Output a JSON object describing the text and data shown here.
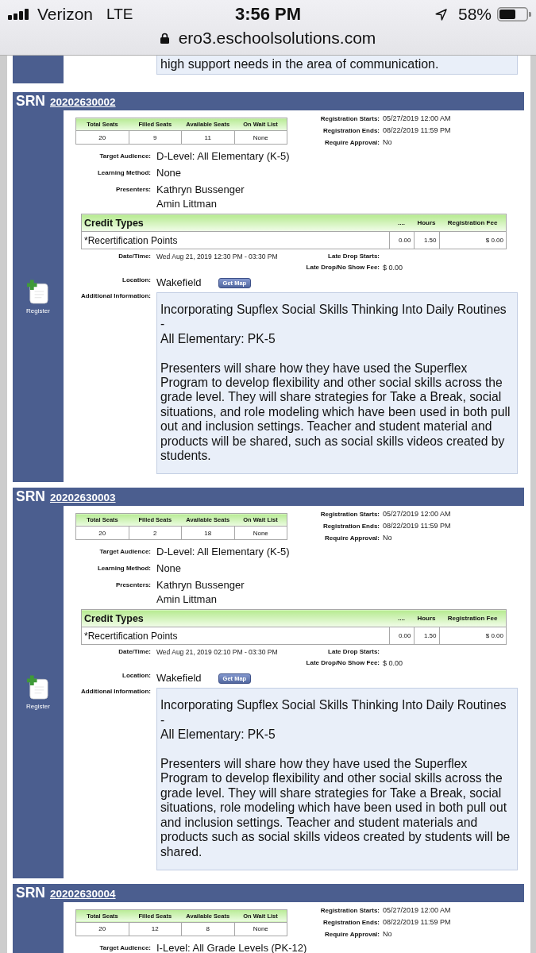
{
  "status_bar": {
    "carrier": "Verizon",
    "network": "LTE",
    "time": "3:56 PM",
    "battery": "58%",
    "url": "ero3.eschoolsolutions.com"
  },
  "previous_section": {
    "info_text": "high support needs in the area of communication."
  },
  "sections": [
    {
      "srn_label": "SRN",
      "srn": "20202630002",
      "seats": {
        "columns": [
          "Total Seats",
          "Filled Seats",
          "Available Seats",
          "On Wait List"
        ],
        "values": [
          "20",
          "9",
          "11",
          "None"
        ]
      },
      "registration": [
        {
          "label": "Registration Starts:",
          "value": "05/27/2019 12:00 AM"
        },
        {
          "label": "Registration Ends:",
          "value": "08/22/2019 11:59 PM"
        },
        {
          "label": "Require Approval:",
          "value": "No"
        }
      ],
      "details": [
        {
          "label": "Target Audience:",
          "values": [
            "D-Level: All Elementary (K-5)"
          ]
        },
        {
          "label": "Learning Method:",
          "values": [
            "None"
          ]
        },
        {
          "label": "Presenters:",
          "values": [
            "Kathryn Bussenger",
            "Amin Littman"
          ]
        }
      ],
      "credit_types": {
        "columns": [
          "Credit Types",
          "....",
          "Hours",
          "Registration Fee"
        ],
        "rows": [
          [
            "*Recertification Points",
            "0.00",
            "1.50",
            "$ 0.00"
          ]
        ]
      },
      "schedule": {
        "date_label": "Date/Time:",
        "date_value": "Wed Aug 21, 2019 12:30 PM - 03:30 PM",
        "late_drop_label": "Late Drop Starts:",
        "fee_label": "Late Drop/No Show Fee:",
        "fee_value": "$ 0.00"
      },
      "location": {
        "label": "Location:",
        "value": "Wakefield",
        "map_button": "Get Map"
      },
      "register_label": "Register",
      "additional_info": {
        "label": "Additional Information:",
        "title_lines": [
          "Incorporating Supflex Social Skills Thinking Into Daily Routines",
          "-",
          "All Elementary: PK-5"
        ],
        "description": "Presenters will share how they have used the Superflex Program to develop flexibility and other social skills across the grade level. They will share strategies for Take a Break, social situations, and role modeling which have been used in both pull out and inclusion settings. Teacher and student material and products will be shared, such as social skills videos created by students."
      }
    },
    {
      "srn_label": "SRN",
      "srn": "20202630003",
      "seats": {
        "columns": [
          "Total Seats",
          "Filled Seats",
          "Available Seats",
          "On Wait List"
        ],
        "values": [
          "20",
          "2",
          "18",
          "None"
        ]
      },
      "registration": [
        {
          "label": "Registration Starts:",
          "value": "05/27/2019 12:00 AM"
        },
        {
          "label": "Registration Ends:",
          "value": "08/22/2019 11:59 PM"
        },
        {
          "label": "Require Approval:",
          "value": "No"
        }
      ],
      "details": [
        {
          "label": "Target Audience:",
          "values": [
            "D-Level: All Elementary (K-5)"
          ]
        },
        {
          "label": "Learning Method:",
          "values": [
            "None"
          ]
        },
        {
          "label": "Presenters:",
          "values": [
            "Kathryn Bussenger",
            "Amin Littman"
          ]
        }
      ],
      "credit_types": {
        "columns": [
          "Credit Types",
          "....",
          "Hours",
          "Registration Fee"
        ],
        "rows": [
          [
            "*Recertification Points",
            "0.00",
            "1.50",
            "$ 0.00"
          ]
        ]
      },
      "schedule": {
        "date_label": "Date/Time:",
        "date_value": "Wed Aug 21, 2019 02:10 PM - 03:30 PM",
        "late_drop_label": "Late Drop Starts:",
        "fee_label": "Late Drop/No Show Fee:",
        "fee_value": "$ 0.00"
      },
      "location": {
        "label": "Location:",
        "value": "Wakefield",
        "map_button": "Get Map"
      },
      "register_label": "Register",
      "additional_info": {
        "label": "Additional Information:",
        "title_lines": [
          "Incorporating Supflex Social Skills Thinking Into Daily Routines",
          "-",
          "All Elementary: PK-5"
        ],
        "description": "Presenters will share how they have used the Superflex Program to develop flexibility and other social skills across the grade level. They will share strategies for Take a Break, social situations, role modeling which have been used in both pull out and inclusion settings. Teacher and student materials and products such as social skills videos created by students will be shared."
      }
    },
    {
      "srn_label": "SRN",
      "srn": "20202630004",
      "seats": {
        "columns": [
          "Total Seats",
          "Filled Seats",
          "Available Seats",
          "On Wait List"
        ],
        "values": [
          "20",
          "12",
          "8",
          "None"
        ]
      },
      "registration": [
        {
          "label": "Registration Starts:",
          "value": "05/27/2019 12:00 AM"
        },
        {
          "label": "Registration Ends:",
          "value": "08/22/2019 11:59 PM"
        },
        {
          "label": "Require Approval:",
          "value": "No"
        }
      ],
      "details": [
        {
          "label": "Target Audience:",
          "values": [
            "I-Level: All Grade Levels (PK-12)"
          ]
        }
      ]
    }
  ]
}
